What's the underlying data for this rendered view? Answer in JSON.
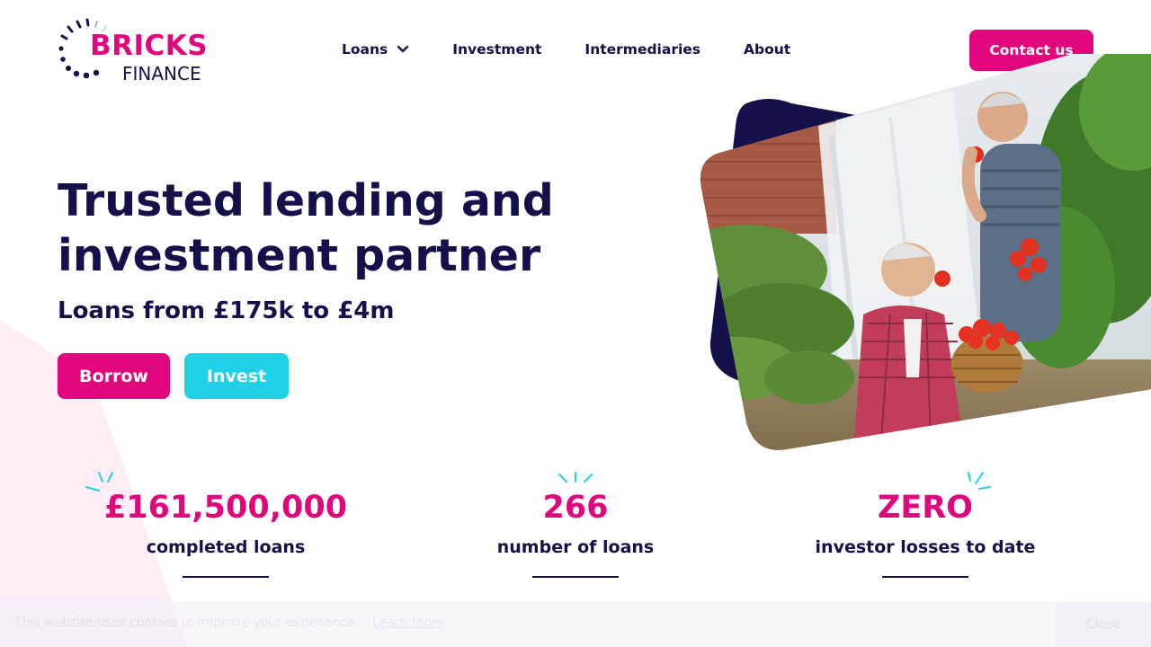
{
  "header": {
    "logo": {
      "brand_top": "BRICKS",
      "brand_bottom": "FINANCE"
    },
    "nav": [
      {
        "label": "Loans",
        "has_dropdown": true
      },
      {
        "label": "Investment"
      },
      {
        "label": "Intermediaries"
      },
      {
        "label": "About"
      }
    ],
    "contact_label": "Contact us"
  },
  "hero": {
    "title_line1": "Trusted lending and",
    "title_line2": "investment partner",
    "subtitle": "Loans from £175k to £4m",
    "borrow_label": "Borrow",
    "invest_label": "Invest",
    "image_icon": "photo-two-men-eating-tomatoes-in-greenhouse"
  },
  "stats": [
    {
      "value": "£161,500,000",
      "label": "completed loans"
    },
    {
      "value": "266",
      "label": "number of loans"
    },
    {
      "value": "ZERO",
      "label": "investor losses to date"
    }
  ],
  "cookie": {
    "text": "This website uses cookies to improve your experience.",
    "link_label": "Learn more",
    "button_label": "Close"
  },
  "colors": {
    "brand_pink": "#e0077d",
    "brand_navy": "#13104a",
    "brand_cyan": "#1fd0e6",
    "wedge_pink": "#fdeef5"
  }
}
